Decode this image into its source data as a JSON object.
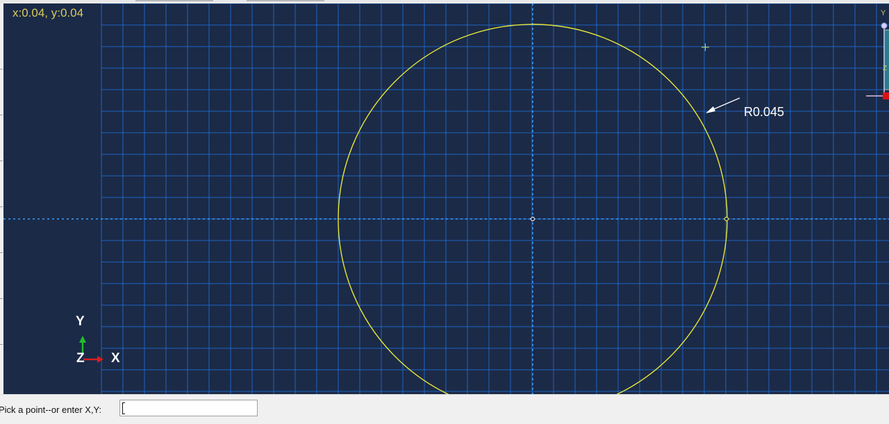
{
  "viewport": {
    "cursor_readout": "x:0.04, y:0.04",
    "background_color": "#1b2a47",
    "grid_color": "#1f6fd6",
    "sketch_color": "#e6e63a"
  },
  "sketch": {
    "entity": "circle",
    "radius_dimension_label": "R0.045"
  },
  "triad": {
    "y_label": "Y",
    "z_label": "Z",
    "x_label": "X",
    "y_axis_color": "#1fbf2a",
    "x_axis_color": "#d42020"
  },
  "view_cube": {
    "y_label": "Y"
  },
  "prompt": {
    "label": "Pick a point--or enter X,Y:",
    "value": ""
  }
}
